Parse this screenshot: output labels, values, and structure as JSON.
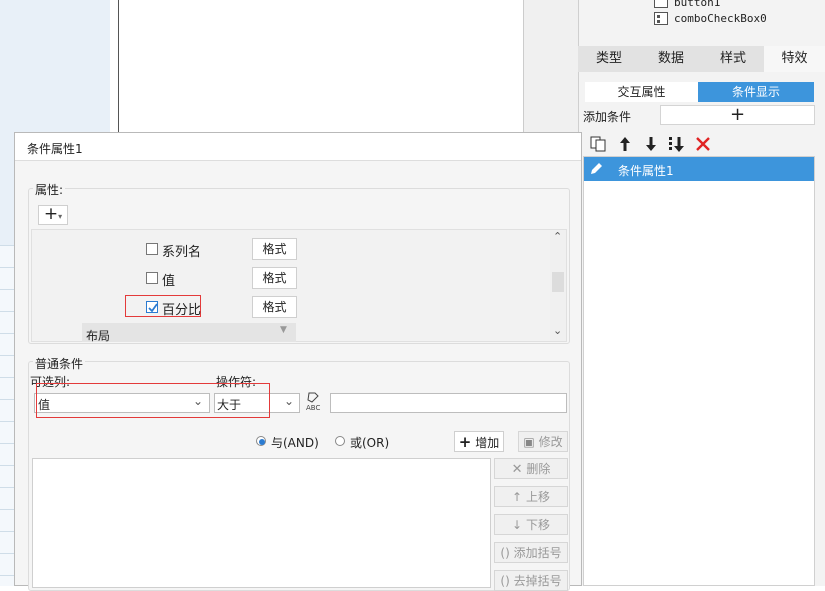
{
  "right_panel": {
    "tree": [
      {
        "label": "button1"
      },
      {
        "label": "comboCheckBox0"
      }
    ],
    "tabs": [
      "类型",
      "数据",
      "样式",
      "特效"
    ],
    "subtabs": [
      "交互属性",
      "条件显示"
    ],
    "add_condition_label": "添加条件",
    "add_button_glyph": "+",
    "list_items": [
      "条件属性1"
    ],
    "accent_color": "#3d95dc"
  },
  "dialog": {
    "title": "条件属性1",
    "attributes": {
      "group_label": "属性:",
      "add_glyph": "+",
      "rows": [
        {
          "label": "系列名",
          "checked": false,
          "button": "格式"
        },
        {
          "label": "值",
          "checked": false,
          "button": "格式"
        },
        {
          "label": "百分比",
          "checked": true,
          "button": "格式"
        }
      ],
      "layout_label": "布局"
    },
    "conditions": {
      "group_label": "普通条件",
      "column_label": "可选列:",
      "column_value": "值",
      "operator_label": "操作符:",
      "operator_value": "大于",
      "value_input": "",
      "and_label": "与(AND)",
      "or_label": "或(OR)",
      "add_button": "增加",
      "modify_button": "修改",
      "side_buttons": [
        "删除",
        "上移",
        "下移",
        "添加括号",
        "去掉括号"
      ]
    }
  }
}
